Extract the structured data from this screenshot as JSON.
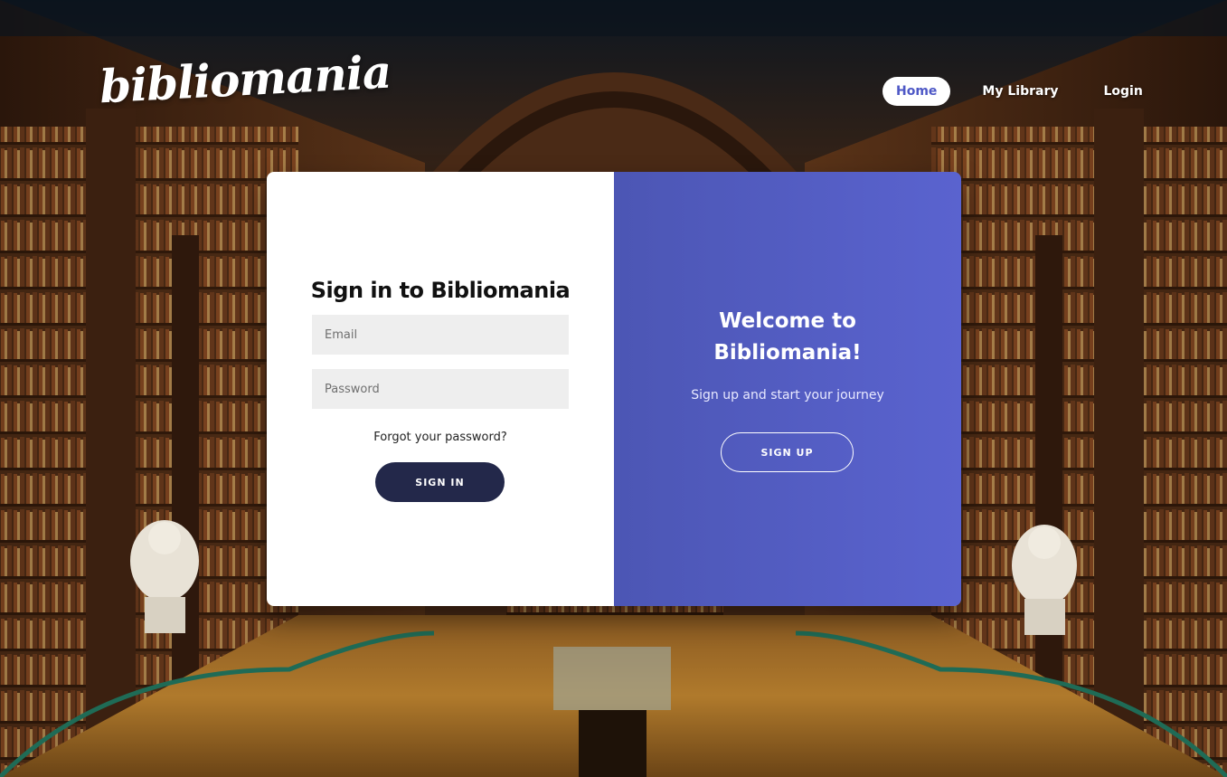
{
  "brand": {
    "logo_text": "bibliomania"
  },
  "nav": {
    "home": "Home",
    "my_library": "My Library",
    "login": "Login"
  },
  "signin": {
    "title": "Sign in to Bibliomania",
    "email_placeholder": "Email",
    "password_placeholder": "Password",
    "forgot_password": "Forgot your password?",
    "button": "SIGN IN"
  },
  "signup": {
    "title_line1": "Welcome to",
    "title_line2": "Bibliomania!",
    "subtitle": "Sign up and start your journey",
    "button": "SIGN UP"
  },
  "colors": {
    "accent": "#5a63cf",
    "signin_button": "#23284a",
    "field_bg": "#eeeeee"
  }
}
